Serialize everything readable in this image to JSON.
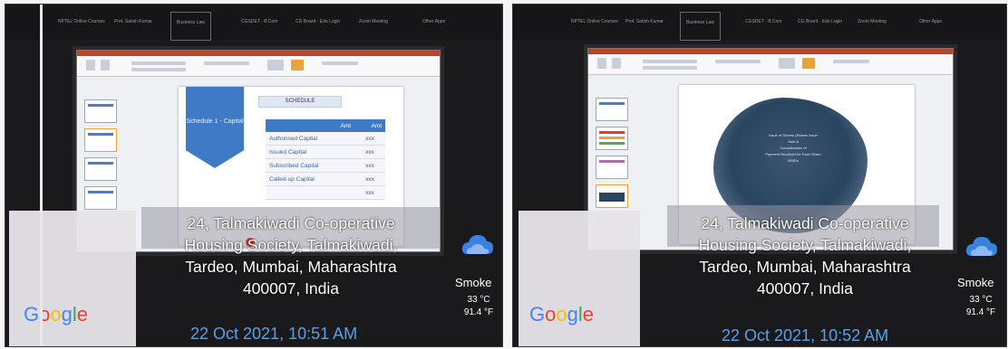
{
  "top_tabs_1": [
    "NPTEL Online Courses",
    "Prof. Satish Kumar",
    "Business Law",
    "CGSDET - B.Com",
    "CG Board - Edu Login",
    "Zoom Meeting",
    "Other Apps"
  ],
  "top_tabs_2": [
    "NPTEL Online Courses",
    "Prof. Satish Kumar",
    "Business Law",
    "CGSDET - B.Com",
    "CG Board - Edu Login",
    "Zoom Meeting",
    "Other Apps"
  ],
  "slide1": {
    "banner": "Schedule 1 - Capital",
    "title_box": "SCHEDULE",
    "table_header": [
      "Amt",
      "Amt"
    ],
    "rows": [
      {
        "label": "Authorised Capital",
        "value": "xxx"
      },
      {
        "label": "Issued Capital",
        "value": "xxx"
      },
      {
        "label": "Subscribed Capital",
        "value": "xxx"
      },
      {
        "label": "Called-up Capital",
        "value": "xxx"
      },
      {
        "label": "",
        "value": "xxx"
      }
    ]
  },
  "slide2": {
    "lines": [
      "Issue of Shares (Shares Issue",
      "Sale &",
      "Consideration of",
      "Payment Received for Each Share",
      "800Rs"
    ]
  },
  "overlay1": {
    "address_lines": [
      "24, Talmakiwadi Co-operative",
      "Housing Society, Talmakiwadi,",
      "Tardeo, Mumbai, Maharashtra",
      "400007, India"
    ],
    "datetime": "22 Oct 2021, 10:51 AM",
    "condition": "Smoke",
    "temp_c": "33 °C",
    "temp_f": "91.4 °F",
    "brand": "Google"
  },
  "overlay2": {
    "address_lines": [
      "24, Talmakiwadi Co-operative",
      "Housing Society, Talmakiwadi,",
      "Tardeo, Mumbai, Maharashtra",
      "400007, India"
    ],
    "datetime": "22 Oct 2021, 10:52 AM",
    "condition": "Smoke",
    "temp_c": "33 °C",
    "temp_f": "91.4 °F",
    "brand": "Google"
  },
  "colors": {
    "accent": "#3f7ac6",
    "datetime": "#5aa0e8",
    "cloud": "#3a82e0"
  },
  "icons": {
    "weather": "cloud-icon"
  }
}
